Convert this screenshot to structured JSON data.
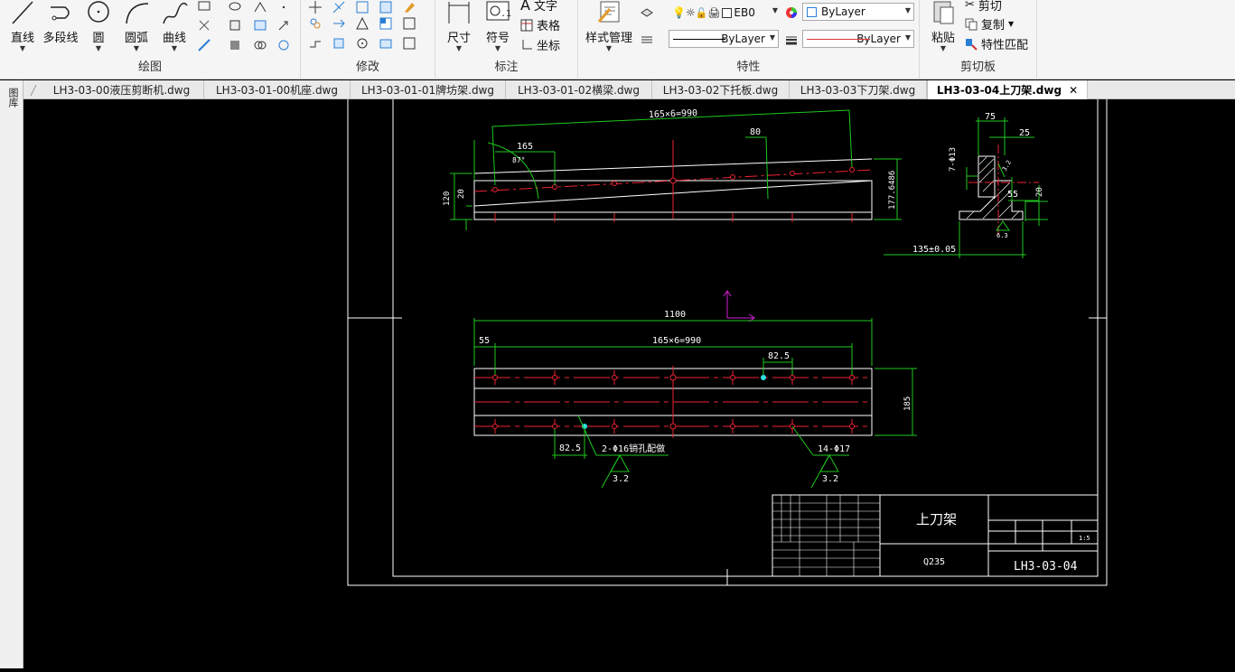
{
  "ribbon": {
    "draw": {
      "title": "绘图",
      "line": "直线",
      "polyline": "多段线",
      "circle": "圆",
      "arc": "圆弧",
      "curve": "曲线"
    },
    "modify": {
      "title": "修改"
    },
    "annotate": {
      "title": "标注",
      "dimension": "尺寸",
      "symbol": "符号",
      "text": "文字",
      "table": "表格",
      "coordinate": "坐标"
    },
    "properties": {
      "title": "特性",
      "style_manager": "样式管理",
      "layer_value": "EB0",
      "color_value": "ByLayer",
      "linetype_value": "ByLayer",
      "lineweight_value": "ByLayer"
    },
    "clipboard": {
      "title": "剪切板",
      "paste": "粘贴",
      "cut": "剪切",
      "copy": "复制",
      "match": "特性匹配"
    }
  },
  "tabs": [
    {
      "label": "LH3-03-00液压剪断机.dwg",
      "active": false
    },
    {
      "label": "LH3-03-01-00机座.dwg",
      "active": false
    },
    {
      "label": "LH3-03-01-01牌坊架.dwg",
      "active": false
    },
    {
      "label": "LH3-03-01-02横梁.dwg",
      "active": false
    },
    {
      "label": "LH3-03-02下托板.dwg",
      "active": false
    },
    {
      "label": "LH3-03-03下刀架.dwg",
      "active": false
    },
    {
      "label": "LH3-03-04上刀架.dwg",
      "active": true
    }
  ],
  "sidebar": {
    "label": "图库"
  },
  "drawing": {
    "dims": {
      "top_overall": "165×6=990",
      "top_165": "165",
      "top_80": "80",
      "top_angle": "87°",
      "top_120": "120",
      "top_20": "20",
      "top_177": "177.6486",
      "side_75": "75",
      "side_25": "25",
      "side_holes": "7-Φ13",
      "side_55": "55",
      "side_20": "20",
      "side_135": "135±0.05",
      "side_32": "3.2",
      "side_63": "6.3",
      "plan_1100": "1100",
      "plan_55": "55",
      "plan_990": "165×6=990",
      "plan_825_top": "82.5",
      "plan_185": "185",
      "plan_825_bottom": "82.5",
      "plan_pin": "2-Φ16销孔配做",
      "plan_holes": "14-Φ17",
      "rough_1": "3.2",
      "rough_2": "3.2"
    },
    "titleblock": {
      "part_name": "上刀架",
      "material": "Q235",
      "drawing_no": "LH3-03-04",
      "scale": "1:5"
    }
  }
}
